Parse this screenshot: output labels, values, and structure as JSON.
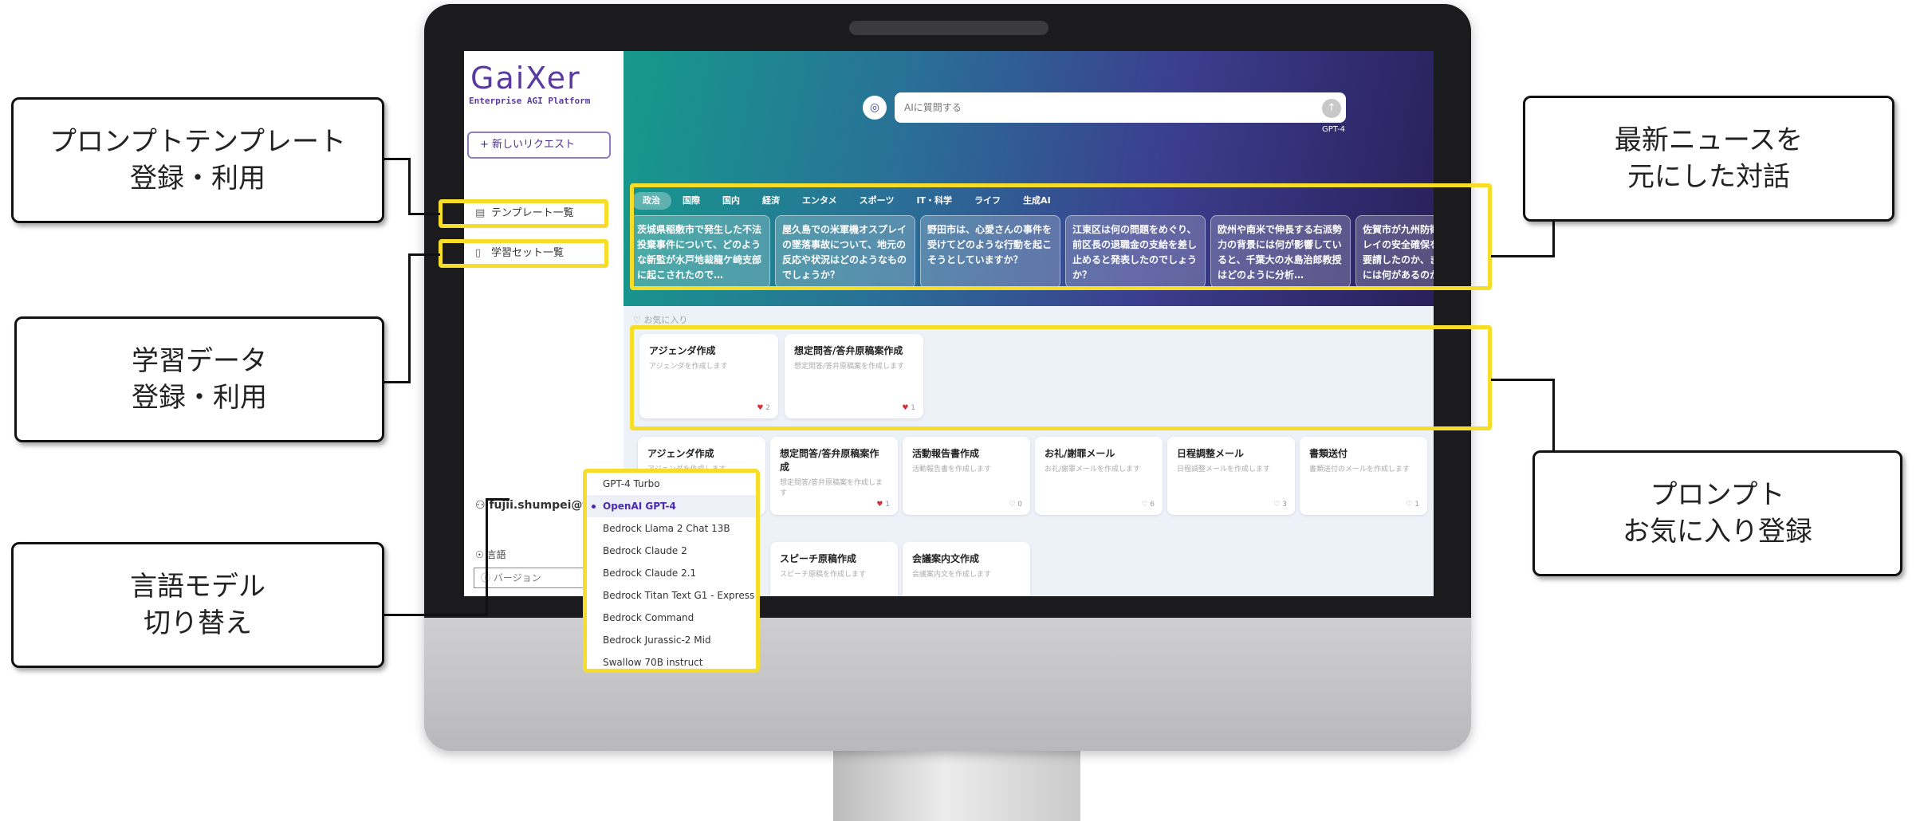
{
  "app": {
    "logo_text": "GaiXer",
    "logo_subtitle": "Enterprise AGI Platform",
    "new_request_label": "+ 新しいリクエスト"
  },
  "sidebar": {
    "items": [
      {
        "icon": "template-icon",
        "label": "テンプレート一覧"
      },
      {
        "icon": "book-icon",
        "label": "学習セット一覧"
      }
    ],
    "user_name": "fujii.shumpei@f",
    "language_label": "言語",
    "version_placeholder": "バージョン"
  },
  "search": {
    "placeholder": "AIに質問する",
    "model_label": "GPT-4"
  },
  "news": {
    "tabs": [
      "政治",
      "国際",
      "国内",
      "経済",
      "エンタメ",
      "スポーツ",
      "IT・科学",
      "ライフ",
      "生成AI"
    ],
    "active_tab": 0,
    "cards": [
      "茨城県稲敷市で発生した不法投棄事件について、どのような新監が水戸地裁龍ケ崎支部に起こされたので…",
      "屋久島での米軍機オスプレイの墜落事故について、地元の反応や状況はどのようなものでしょうか？",
      "野田市は、心愛さんの事件を受けてどのような行動を起こそうとしていますか？",
      "江東区は何の問題をめぐり、前区長の退職金の支給を差し止めると発表したのでしょうか？",
      "欧州や南米で伸長する右派勢力の背景には何が影響していると、千葉大の水島治郎教授はどのように分析…",
      "佐賀市が九州防衛局にオスプレイの安全確保をどのように要請したのか、またその背景には何があるのか？"
    ]
  },
  "favorites": {
    "label": "♡ お気に入り",
    "cards": [
      {
        "title": "アジェンダ作成",
        "desc": "アジェンダを作成します",
        "count": "2"
      },
      {
        "title": "想定問答/答弁原稿案作成",
        "desc": "想定問答/答弁原稿案を作成します",
        "count": "1"
      }
    ]
  },
  "prompts": {
    "cards": [
      {
        "title": "アジェンダ作成",
        "desc": "アジェンダを作成します",
        "count": ""
      },
      {
        "title": "想定問答/答弁原稿案作成",
        "desc": "想定問答/答弁原稿案を作成します",
        "count": "1"
      },
      {
        "title": "活動報告書作成",
        "desc": "活動報告書を作成します",
        "count": "0"
      },
      {
        "title": "お礼/謝罪メール",
        "desc": "お礼/謝罪メールを作成します",
        "count": "6"
      },
      {
        "title": "日程調整メール",
        "desc": "日程調整メールを作成します",
        "count": "3"
      },
      {
        "title": "書類送付",
        "desc": "書類送付のメールを作成します",
        "count": "1"
      },
      {
        "title": "スピーチ原稿作成",
        "desc": "スピーチ原稿を作成します",
        "count": ""
      },
      {
        "title": "会議案内文作成",
        "desc": "会議案内文を作成します",
        "count": ""
      }
    ]
  },
  "model_dropdown": {
    "options": [
      "GPT-4 Turbo",
      "OpenAI GPT-4",
      "Bedrock Llama 2 Chat 13B",
      "Bedrock Claude 2",
      "Bedrock Claude 2.1",
      "Bedrock Titan Text G1 - Express",
      "Bedrock Command",
      "Bedrock Jurassic-2 Mid",
      "Swallow 70B instruct"
    ],
    "selected": "OpenAI GPT-4"
  },
  "callouts": {
    "prompt_template": [
      "プロンプトテンプレート",
      "登録・利用"
    ],
    "learning_data": [
      "学習データ",
      "登録・利用"
    ],
    "language_model": [
      "言語モデル",
      "切り替え"
    ],
    "latest_news": [
      "最新ニュースを",
      "元にした対話"
    ],
    "prompt_favorite": [
      "プロンプト",
      "お気に入り登録"
    ]
  },
  "colors": {
    "highlight": "#f5dd2a",
    "accent": "#4b2ab0",
    "heart": "#d32f3a"
  }
}
